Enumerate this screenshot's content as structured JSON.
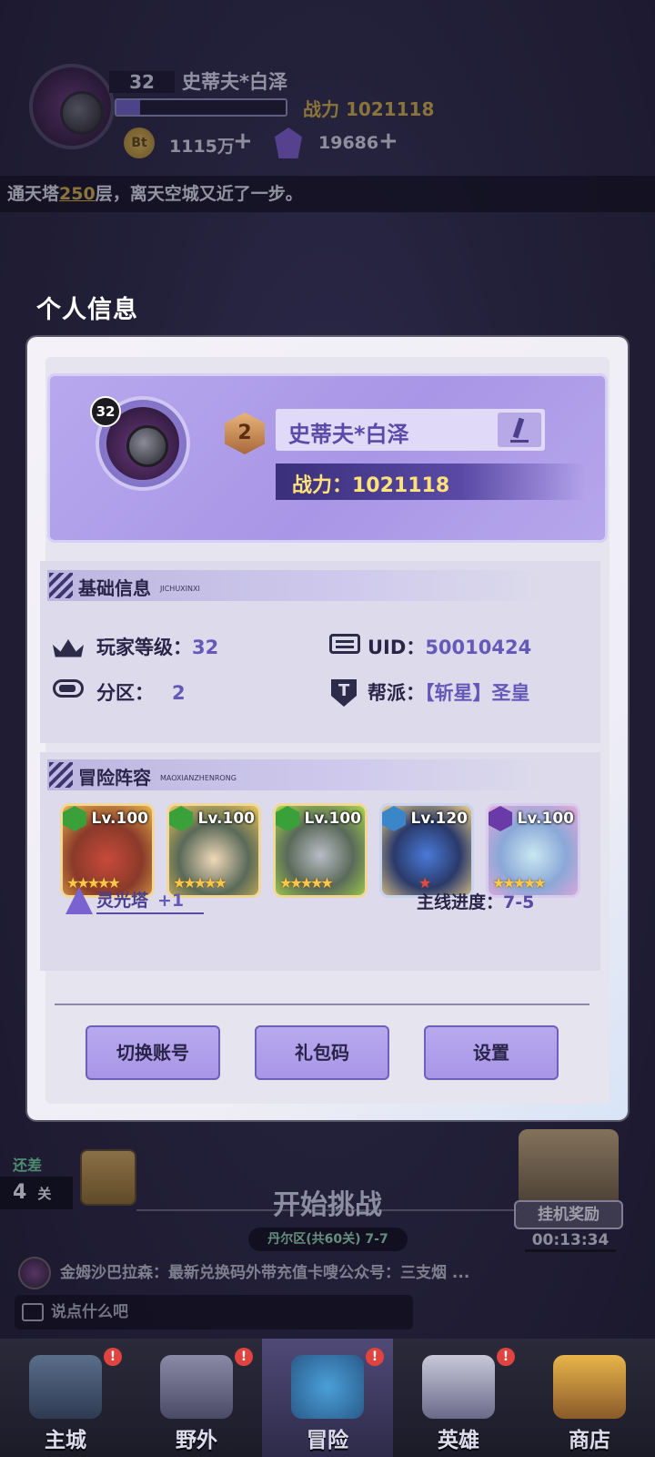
{
  "hud": {
    "level": "32",
    "name": "史蒂夫*白泽",
    "power_label": "战力 1021118",
    "xp_fraction": 0.14,
    "coin_icon_text": "Bt",
    "coins": "1115万",
    "gems": "19686",
    "plus": "+"
  },
  "ticker": {
    "prefix": "通天塔",
    "floor": "250",
    "suffix": "层，离天空城又近了一步。"
  },
  "panel_title": "个人信息",
  "profile": {
    "level": "32",
    "rank": "2",
    "name": "史蒂夫*白泽",
    "power": "战力：1021118"
  },
  "basic_info": {
    "title": "基础信息",
    "subtitle": "JICHUXINXI",
    "player_level_label": "玩家等级：",
    "player_level": "32",
    "uid_label": "UID：",
    "uid": "50010424",
    "server_label": "分区：",
    "server": "2",
    "guild_label": "帮派：",
    "guild": "【斩星】圣皇"
  },
  "lineup": {
    "title": "冒险阵容",
    "subtitle": "MAOXIANZHENRONG",
    "heroes": [
      {
        "level": "Lv.100",
        "stars": "★★★★★",
        "element": "nature",
        "elem_color": "#3aa03a"
      },
      {
        "level": "Lv.100",
        "stars": "★★★★★",
        "element": "nature",
        "elem_color": "#3aa03a"
      },
      {
        "level": "Lv.100",
        "stars": "★★★★★",
        "element": "nature",
        "elem_color": "#3aa03a"
      },
      {
        "level": "Lv.120",
        "stars": "★",
        "element": "water",
        "elem_color": "#3a86c8"
      },
      {
        "level": "Lv.100",
        "stars": "★★★★★",
        "element": "shadow",
        "elem_color": "#6a3aa8"
      }
    ],
    "tower_label": "灵光塔",
    "tower_bonus": "+1",
    "mainline_label": "主线进度：",
    "mainline_value": "7-5"
  },
  "buttons": {
    "switch": "切换账号",
    "gift": "礼包码",
    "settings": "设置"
  },
  "game": {
    "remain_label": "还差",
    "remain_count": "4",
    "remain_unit": "关",
    "start": "开始挑战",
    "stage": "丹尔区(共60关) 7-7",
    "afk": "挂机奖励",
    "afk_time": "00:13:34",
    "chat": "金姆沙巴拉森：最新兑换码外带充值卡嗖公众号：三支烟 ...",
    "chat_placeholder": "说点什么吧"
  },
  "nav": [
    {
      "label": "主城",
      "badge": "!"
    },
    {
      "label": "野外",
      "badge": "!"
    },
    {
      "label": "冒险",
      "badge": "!"
    },
    {
      "label": "英雄",
      "badge": "!"
    },
    {
      "label": "商店",
      "badge": ""
    }
  ],
  "colors": {
    "accent": "#6658b8",
    "power_gold": "#ffe27a",
    "card_purple": "#b7a8ee",
    "badge_red": "#e0443e"
  }
}
